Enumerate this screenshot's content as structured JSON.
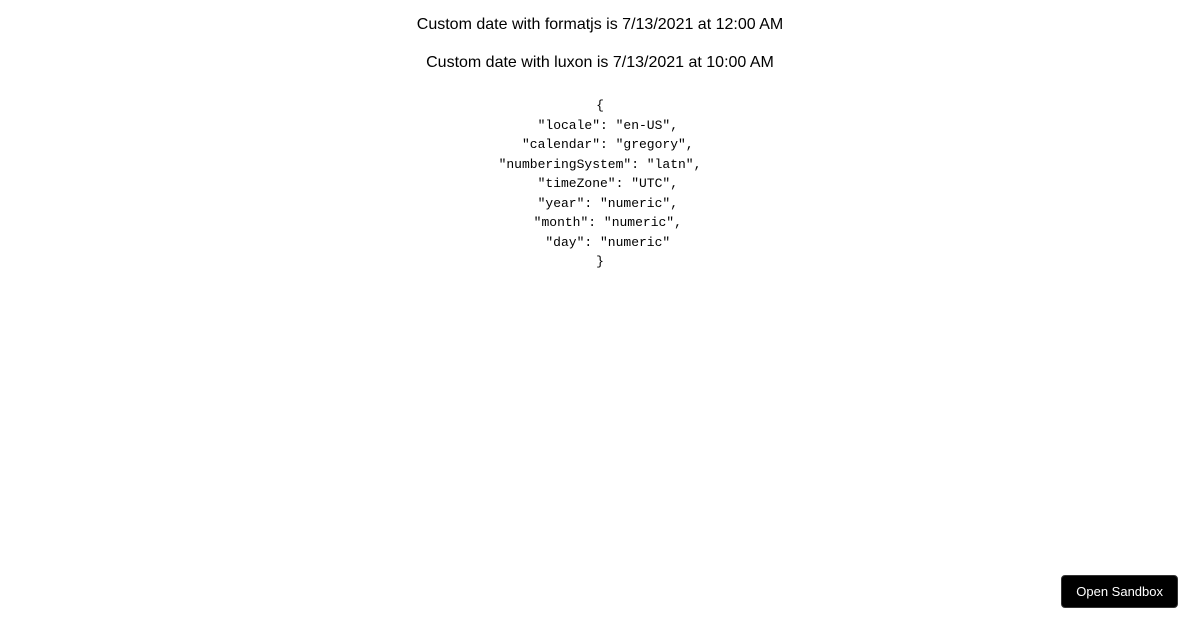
{
  "lines": {
    "formatjs": "Custom date with formatjs is 7/13/2021 at 12:00 AM",
    "luxon": "Custom date with luxon is 7/13/2021 at 10:00 AM"
  },
  "jsonDump": "{\n  \"locale\": \"en-US\",\n  \"calendar\": \"gregory\",\n\"numberingSystem\": \"latn\",\n  \"timeZone\": \"UTC\",\n  \"year\": \"numeric\",\n  \"month\": \"numeric\",\n  \"day\": \"numeric\"\n}",
  "button": {
    "openSandbox": "Open Sandbox"
  }
}
